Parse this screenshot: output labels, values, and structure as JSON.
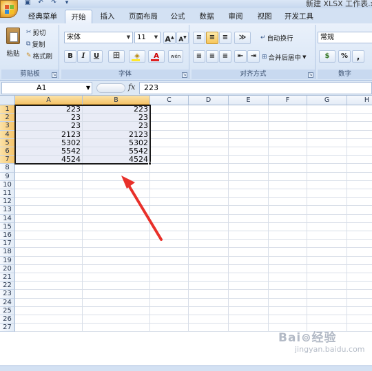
{
  "window": {
    "title": "新建 XLSX 工作表.xlsx"
  },
  "quick_access": {
    "icons": [
      "save-icon",
      "undo-icon",
      "redo-icon",
      "customize-icon"
    ],
    "undo_glyph": "↶",
    "redo_glyph": "↷",
    "save_glyph": "▣",
    "more_glyph": "▾"
  },
  "tabs": [
    "经典菜单",
    "开始",
    "插入",
    "页面布局",
    "公式",
    "数据",
    "审阅",
    "视图",
    "开发工具"
  ],
  "active_tab": "开始",
  "ribbon": {
    "clipboard": {
      "label": "剪贴板",
      "paste": "粘贴",
      "cut": "剪切",
      "copy": "复制",
      "format_painter": "格式刷"
    },
    "font": {
      "label": "字体",
      "font_name": "宋体",
      "font_size": "11",
      "grow": "A",
      "shrink": "A",
      "bold": "B",
      "italic": "I",
      "underline": "U",
      "border": "田",
      "fill": "◈",
      "font_color": "A",
      "phonetic": "wén"
    },
    "alignment": {
      "label": "对齐方式",
      "wrap_text": "自动换行",
      "merge_center": "合并后居中"
    },
    "number": {
      "label": "数字",
      "format": "常规",
      "currency": "$",
      "percent": "%",
      "comma": ","
    }
  },
  "formula_bar": {
    "name_box": "A1",
    "fx": "fx",
    "value": "223"
  },
  "columns": [
    "A",
    "B",
    "C",
    "D",
    "E",
    "F",
    "G",
    "H"
  ],
  "rows": [
    "1",
    "2",
    "3",
    "4",
    "5",
    "6",
    "7",
    "8",
    "9",
    "10",
    "11",
    "12",
    "13",
    "14",
    "15",
    "16",
    "17",
    "18",
    "19",
    "20",
    "21",
    "22",
    "23",
    "24",
    "25",
    "26",
    "27"
  ],
  "cells": [
    [
      "223",
      "223"
    ],
    [
      "23",
      "23"
    ],
    [
      "23",
      "23"
    ],
    [
      "2123",
      "2123"
    ],
    [
      "5302",
      "5302"
    ],
    [
      "5542",
      "5542"
    ],
    [
      "4524",
      "4524"
    ]
  ],
  "selection": {
    "range": "A1:B7"
  },
  "annotation": {
    "color": "#e8302a"
  },
  "watermark": {
    "text": "Bai⊚经验",
    "sub": "jingyan.baidu.com"
  }
}
